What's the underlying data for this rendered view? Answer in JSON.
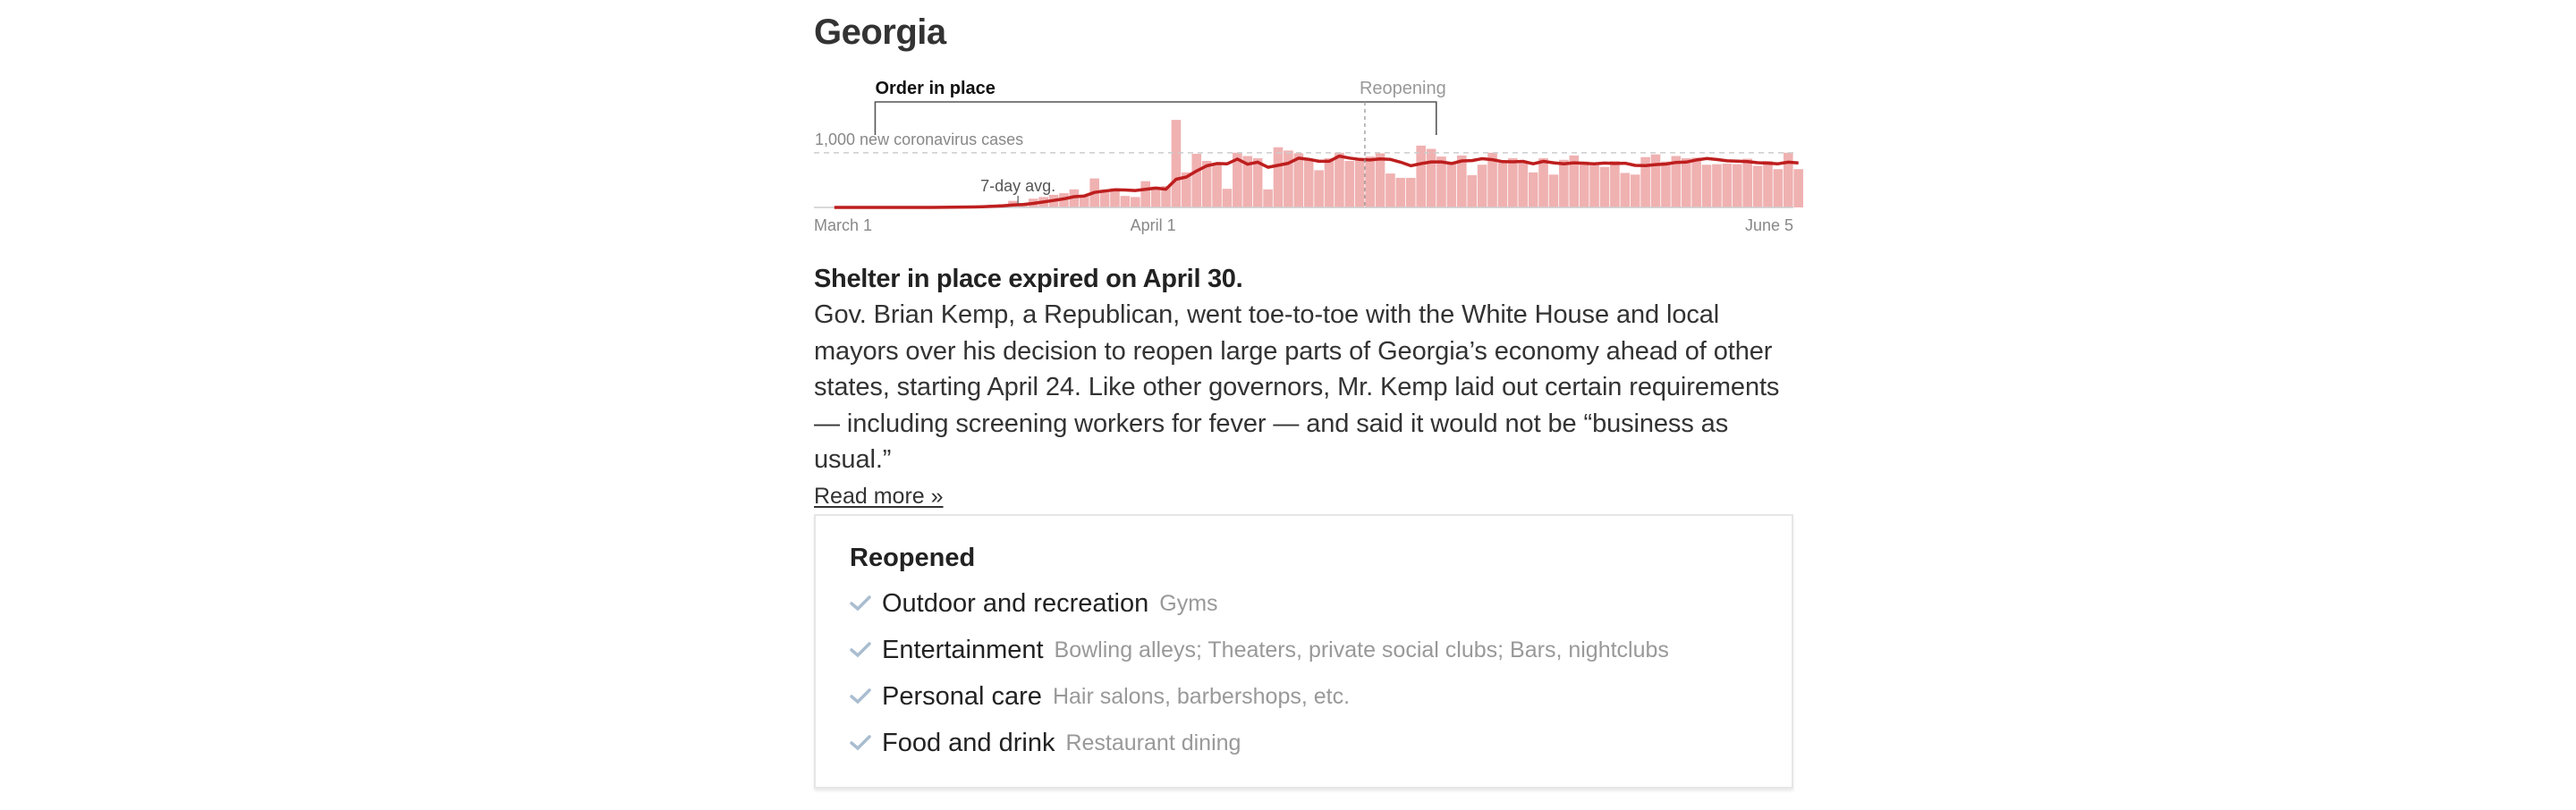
{
  "state": {
    "name": "Georgia"
  },
  "chart_data": {
    "type": "bar",
    "y_reference_label": "1,000 new coronavirus cases",
    "y_reference_value": 1000,
    "avg_label": "7-day avg.",
    "annotations": [
      {
        "label": "Order in place",
        "style": "bold"
      },
      {
        "label": "Reopening",
        "style": "light"
      }
    ],
    "x_labels": [
      {
        "label": "March 1",
        "day": 0
      },
      {
        "label": "April 1",
        "day": 31
      },
      {
        "label": "June 5",
        "day": 96
      }
    ],
    "order_start_day": 3,
    "order_end_day": 61,
    "reopening_day": 54,
    "avg_label_day": 20,
    "ylim": [
      0,
      1700
    ],
    "start_date": "2020-03-01",
    "values": [
      0,
      0,
      0,
      0,
      0,
      0,
      0,
      0,
      0,
      0,
      0,
      3,
      8,
      12,
      20,
      15,
      35,
      50,
      60,
      120,
      80,
      160,
      190,
      230,
      260,
      330,
      220,
      530,
      330,
      350,
      210,
      190,
      480,
      380,
      390,
      1600,
      640,
      980,
      850,
      780,
      340,
      1000,
      940,
      900,
      330,
      1100,
      1040,
      990,
      860,
      680,
      900,
      1000,
      850,
      860,
      930,
      990,
      620,
      540,
      540,
      1130,
      1070,
      930,
      790,
      950,
      590,
      780,
      1000,
      820,
      900,
      850,
      640,
      900,
      600,
      870,
      950,
      840,
      770,
      740,
      850,
      630,
      600,
      920,
      970,
      840,
      940,
      900,
      910,
      780,
      790,
      800,
      790,
      890,
      760,
      850,
      700,
      1000,
      700
    ]
  },
  "text": {
    "headline": "Shelter in place expired on April 30.",
    "paragraph": "Gov. Brian Kemp, a Republican, went toe-to-toe with the White House and local mayors over his decision to reopen large parts of Georgia’s economy ahead of other states, starting April 24. Like other governors, Mr. Kemp laid out certain requirements — including screening workers for fever — and said it would not be “business as usual.”",
    "read_more": "Read more »"
  },
  "reopened": {
    "title": "Reopened",
    "check_color": "#a9bdd0",
    "items": [
      {
        "category": "Outdoor and recreation",
        "details": "Gyms"
      },
      {
        "category": "Entertainment",
        "details": "Bowling alleys; Theaters, private social clubs; Bars, nightclubs"
      },
      {
        "category": "Personal care",
        "details": "Hair salons, barbershops, etc."
      },
      {
        "category": "Food and drink",
        "details": "Restaurant dining"
      }
    ]
  },
  "colors": {
    "bar": "#f0b1b1",
    "avg_line": "#be1e1e",
    "annotation": "#555555"
  }
}
